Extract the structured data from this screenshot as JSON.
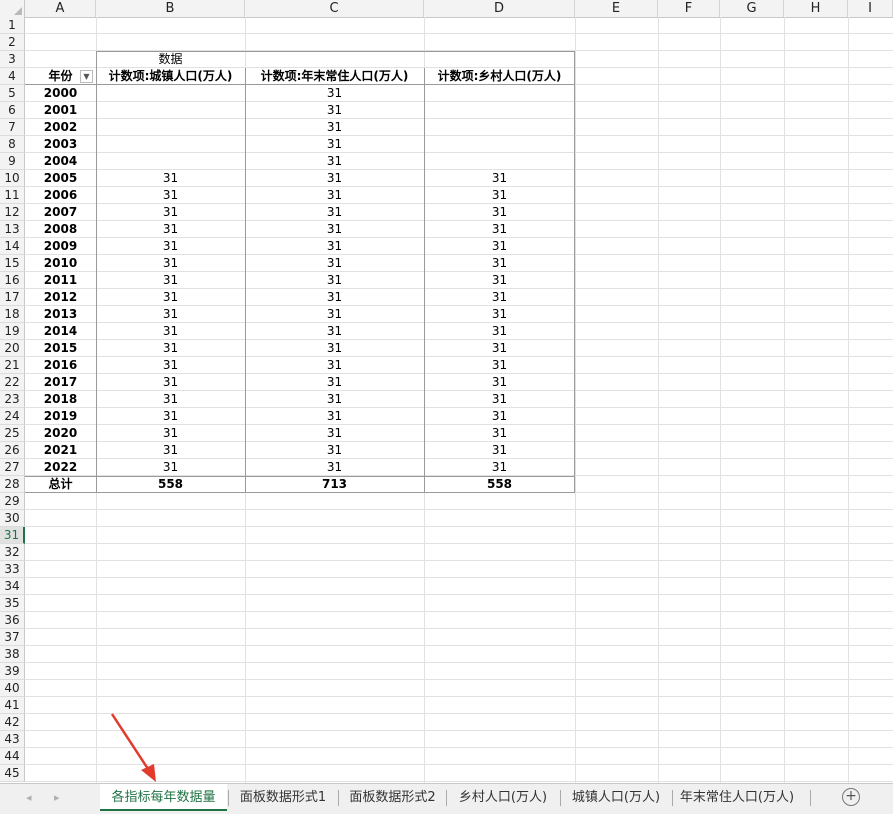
{
  "columns": [
    "A",
    "B",
    "C",
    "D",
    "E",
    "F",
    "G",
    "H",
    "I"
  ],
  "rows": [
    "1",
    "2",
    "3",
    "4",
    "5",
    "6",
    "7",
    "8",
    "9",
    "10",
    "11",
    "12",
    "13",
    "14",
    "15",
    "16",
    "17",
    "18",
    "19",
    "20",
    "21",
    "22",
    "23",
    "24",
    "25",
    "26",
    "27",
    "28",
    "29",
    "30",
    "31",
    "32",
    "33",
    "34",
    "35",
    "36",
    "37",
    "38",
    "39",
    "40",
    "41",
    "42",
    "43",
    "44",
    "45"
  ],
  "active_row": "31",
  "pivot": {
    "data_label": "数据",
    "row_field": "年份",
    "filter_icon": "dropdown-filter-icon",
    "headers": [
      "计数项:城镇人口(万人)",
      "计数项:年末常住人口(万人)",
      "计数项:乡村人口(万人)"
    ],
    "years": [
      "2000",
      "2001",
      "2002",
      "2003",
      "2004",
      "2005",
      "2006",
      "2007",
      "2008",
      "2009",
      "2010",
      "2011",
      "2012",
      "2013",
      "2014",
      "2015",
      "2016",
      "2017",
      "2018",
      "2019",
      "2020",
      "2021",
      "2022"
    ],
    "urban": [
      "",
      "",
      "",
      "",
      "",
      "31",
      "31",
      "31",
      "31",
      "31",
      "31",
      "31",
      "31",
      "31",
      "31",
      "31",
      "31",
      "31",
      "31",
      "31",
      "31",
      "31",
      "31"
    ],
    "resident": [
      "31",
      "31",
      "31",
      "31",
      "31",
      "31",
      "31",
      "31",
      "31",
      "31",
      "31",
      "31",
      "31",
      "31",
      "31",
      "31",
      "31",
      "31",
      "31",
      "31",
      "31",
      "31",
      "31"
    ],
    "rural": [
      "",
      "",
      "",
      "",
      "",
      "31",
      "31",
      "31",
      "31",
      "31",
      "31",
      "31",
      "31",
      "31",
      "31",
      "31",
      "31",
      "31",
      "31",
      "31",
      "31",
      "31",
      "31"
    ],
    "total_label": "总计",
    "totals": [
      "558",
      "713",
      "558"
    ]
  },
  "tabs": [
    "各指标每年数据量",
    "面板数据形式1",
    "面板数据形式2",
    "乡村人口(万人)",
    "城镇人口(万人)",
    "年末常住人口(万人)"
  ],
  "active_tab": "各指标每年数据量",
  "nav": {
    "prev": "◂",
    "next": "▸",
    "add": "+"
  },
  "colors": {
    "accent": "#217346",
    "arrow": "#e23b2e"
  }
}
